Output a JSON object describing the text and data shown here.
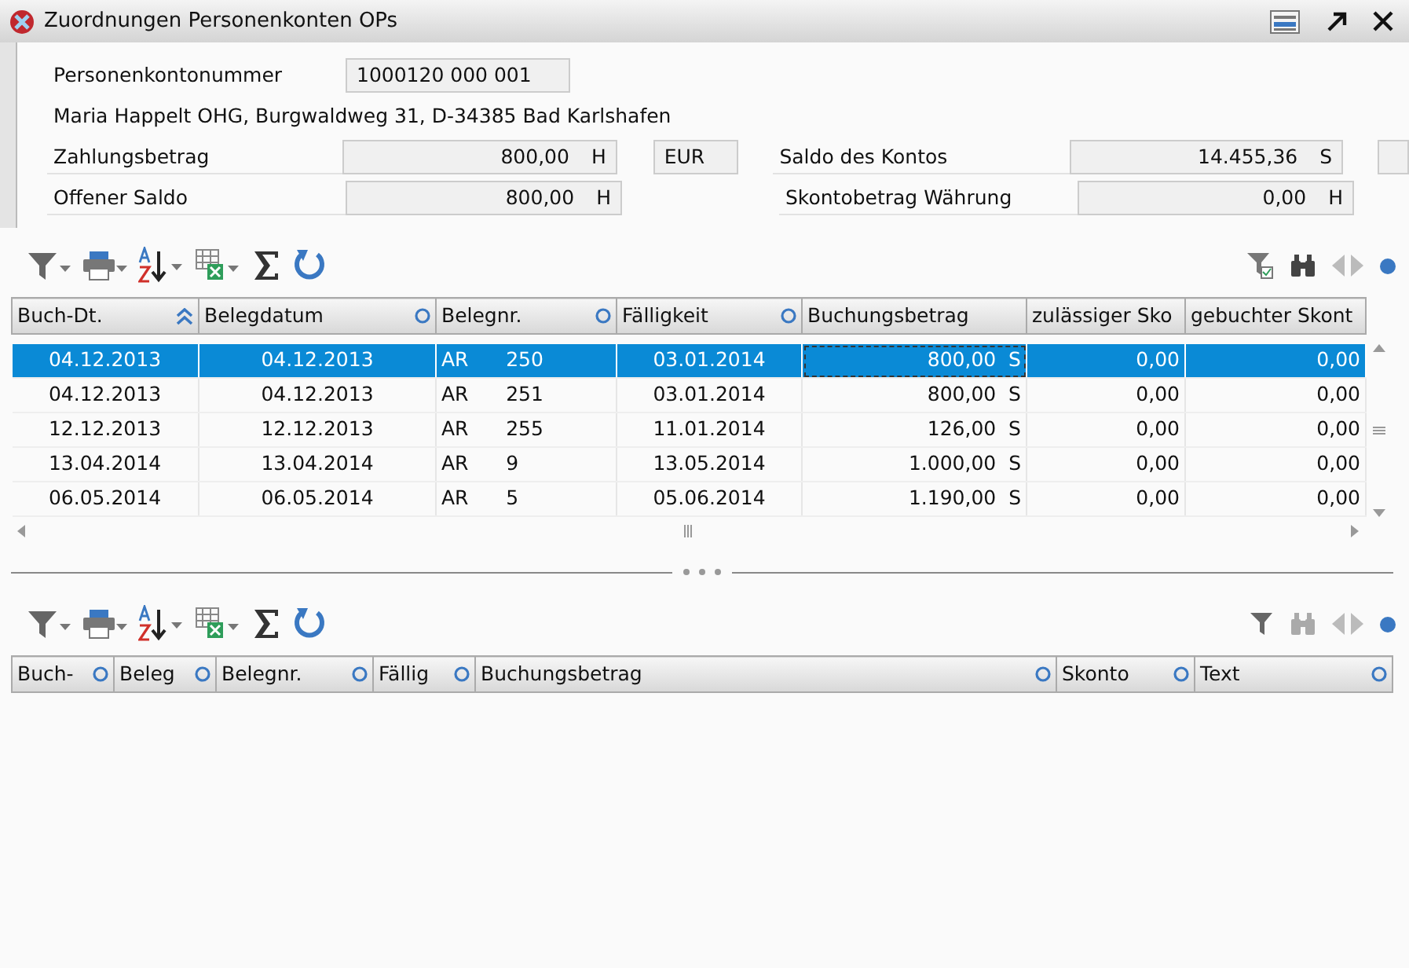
{
  "window": {
    "title": "Zuordnungen Personenkonten OPs"
  },
  "account": {
    "label": "Personenkontonummer",
    "value": "1000120 000 001",
    "address": "Maria Happelt OHG, Burgwaldweg 31, D-34385 Bad Karlshafen"
  },
  "amounts": [
    {
      "label": "Zahlungsbetrag",
      "value": "800,00",
      "side": "H",
      "currency": "EUR",
      "right_label": "Saldo des Kontos",
      "right_value": "14.455,36",
      "right_side": "S"
    },
    {
      "label": "Offener Saldo",
      "value": "800,00",
      "side": "H",
      "right_label": "Skontobetrag Währung",
      "right_value": "0,00",
      "right_side": "H"
    }
  ],
  "table_top": {
    "columns": [
      {
        "label": "Buch-Dt.",
        "sorted": true
      },
      {
        "label": "Belegdatum",
        "sorted": false
      },
      {
        "label": "Belegnr.",
        "sorted": false
      },
      {
        "label": "Fälligkeit",
        "sorted": false
      },
      {
        "label": "Buchungsbetrag"
      },
      {
        "label": "zulässiger Sko"
      },
      {
        "label": "gebuchter Skont"
      }
    ],
    "rows": [
      {
        "selected": true,
        "focused": true,
        "cells": [
          "04.12.2013",
          "04.12.2013",
          {
            "prefix": "AR",
            "number": "250"
          },
          "03.01.2014",
          {
            "value": "800,00",
            "side": "S"
          },
          "0,00",
          "0,00"
        ]
      },
      {
        "selected": false,
        "focused": false,
        "cells": [
          "04.12.2013",
          "04.12.2013",
          {
            "prefix": "AR",
            "number": "251"
          },
          "03.01.2014",
          {
            "value": "800,00",
            "side": "S"
          },
          "0,00",
          "0,00"
        ]
      },
      {
        "selected": false,
        "focused": false,
        "cells": [
          "12.12.2013",
          "12.12.2013",
          {
            "prefix": "AR",
            "number": "255"
          },
          "11.01.2014",
          {
            "value": "126,00",
            "side": "S"
          },
          "0,00",
          "0,00"
        ]
      },
      {
        "selected": false,
        "focused": false,
        "cells": [
          "13.04.2014",
          "13.04.2014",
          {
            "prefix": "AR",
            "number": "9"
          },
          "13.05.2014",
          {
            "value": "1.000,00",
            "side": "S"
          },
          "0,00",
          "0,00"
        ]
      },
      {
        "selected": false,
        "focused": false,
        "cells": [
          "06.05.2014",
          "06.05.2014",
          {
            "prefix": "AR",
            "number": "5"
          },
          "05.06.2014",
          {
            "value": "1.190,00",
            "side": "S"
          },
          "0,00",
          "0,00"
        ]
      }
    ]
  },
  "table_bottom": {
    "columns": [
      {
        "label": "Buch-",
        "sorted": false
      },
      {
        "label": "Beleg",
        "sorted": false
      },
      {
        "label": "Belegnr.",
        "sorted": false
      },
      {
        "label": "Fällig",
        "sorted": false
      },
      {
        "label": "Buchungsbetrag",
        "sorted": false
      },
      {
        "label": "Skonto",
        "sorted": false
      },
      {
        "label": "Text",
        "sorted": false
      }
    ]
  }
}
